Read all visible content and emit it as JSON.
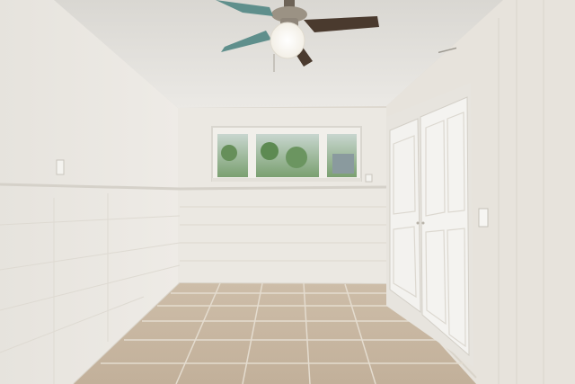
{
  "image": {
    "kind": "photo",
    "scene": "empty-room-interior",
    "colors": {
      "wall": "#e9e6e0",
      "wall_shadow": "#d6d2ca",
      "ceiling": "#e4e2dd",
      "floor_tile": "#c9b8a2",
      "grout": "#e8e2d8",
      "window_frame": "#f2f1ee",
      "foliage": "#6f9660",
      "door": "#f3f2ef",
      "fan_blade": "#4a3a2e",
      "fan_blade_teal": "#5f8f8c"
    }
  }
}
